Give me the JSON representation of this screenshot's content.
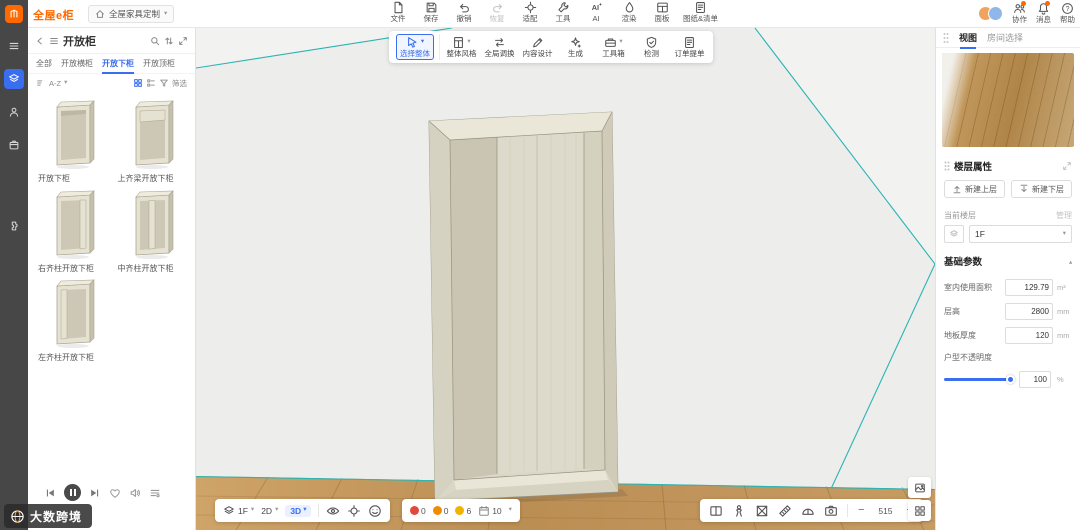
{
  "colors": {
    "accent": "#3a6ef0",
    "brand_orange": "#ff6a00",
    "guide_teal": "#2ab4b2"
  },
  "app": {
    "logo": "全屋e柜",
    "workspace_tab": "全屋家具定制"
  },
  "top_toolbar": {
    "items": [
      {
        "label": "文件"
      },
      {
        "label": "保存"
      },
      {
        "label": "撤销"
      },
      {
        "label": "恢复"
      },
      {
        "label": "适配"
      },
      {
        "label": "工具"
      },
      {
        "label": "AI"
      },
      {
        "label": "渲染"
      },
      {
        "label": "面板"
      },
      {
        "label": "图纸&清单"
      }
    ]
  },
  "top_right": {
    "collab": "协作",
    "messages": "消息",
    "help": "帮助"
  },
  "mode_toolbar": {
    "items": [
      {
        "label": "选择整体"
      },
      {
        "label": "整体风格"
      },
      {
        "label": "全局调换"
      },
      {
        "label": "内容设计"
      },
      {
        "label": "生成"
      },
      {
        "label": "工具箱"
      },
      {
        "label": "检测"
      },
      {
        "label": "订单提单"
      }
    ]
  },
  "left_panel": {
    "title": "开放柜",
    "tabs": [
      {
        "label": "全部"
      },
      {
        "label": "开放横柜"
      },
      {
        "label": "开放下柜"
      },
      {
        "label": "开放顶柜"
      }
    ],
    "sort_label": "A-Z",
    "filter_label": "筛选",
    "products": [
      {
        "name": "开放下柜"
      },
      {
        "name": "上齐梁开放下柜"
      },
      {
        "name": "右齐柱开放下柜"
      },
      {
        "name": "中齐柱开放下柜"
      },
      {
        "name": "左齐柱开放下柜"
      }
    ]
  },
  "viewport_toolbar": {
    "floor": "1F",
    "mode_2d": "2D",
    "mode_3d": "3D",
    "badges": {
      "errors": "0",
      "warnings": "0",
      "coins": "6",
      "days": "10"
    }
  },
  "zoom": {
    "level": "515"
  },
  "right_panel": {
    "tabs": [
      {
        "label": "视图"
      },
      {
        "label": "房间选择"
      }
    ],
    "floor_section": {
      "title": "楼层属性",
      "new_upper": "新建上层",
      "new_lower": "新建下层",
      "current_floor_label": "当前楼层",
      "manage_label": "管理",
      "floor_value": "1F"
    },
    "params": {
      "title": "基础参数",
      "fields": [
        {
          "label": "室内使用面积",
          "value": "129.79",
          "unit": "m²"
        },
        {
          "label": "层高",
          "value": "2800",
          "unit": "mm"
        },
        {
          "label": "地板厚度",
          "value": "120",
          "unit": "mm"
        }
      ],
      "opacity": {
        "label": "户型不透明度",
        "value": "100",
        "unit": "%"
      }
    }
  },
  "watermark": {
    "text": "大数跨境"
  }
}
